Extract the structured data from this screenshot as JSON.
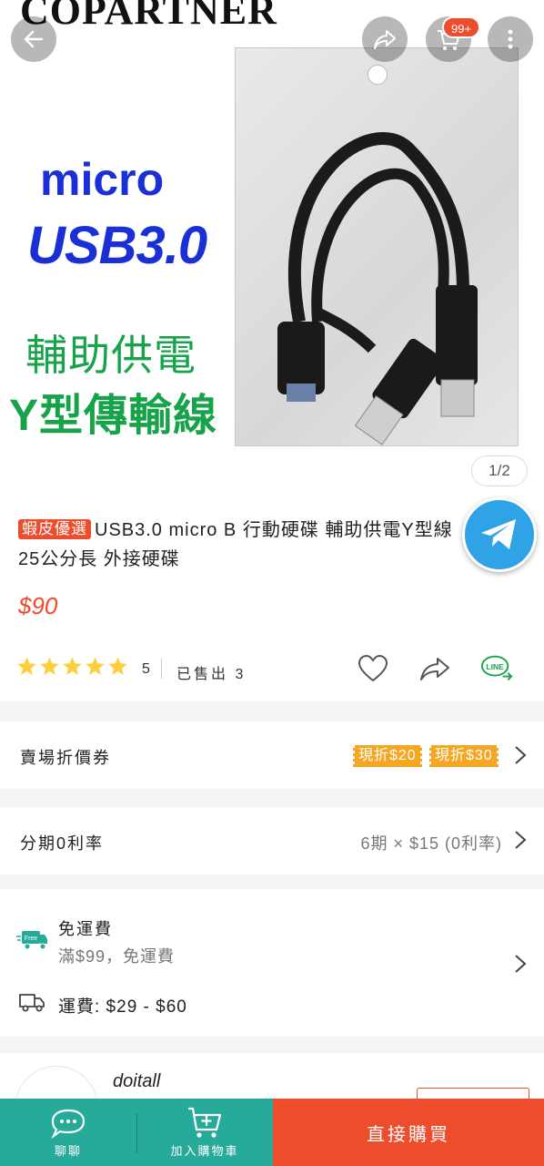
{
  "hero": {
    "brand": "COPARTNER",
    "promo_line1": "micro",
    "promo_line2": "USB3.0",
    "promo_line3": "輔助供電",
    "promo_line4": "Y型傳輸線",
    "cart_badge": "99+",
    "pager": "1/2"
  },
  "product": {
    "tag": "蝦皮優選",
    "title": "USB3.0 micro B 行動硬碟 輔助供電Y型線 25公分長 外接硬碟",
    "price": "$90",
    "rating": "5",
    "sold": "已售出 3",
    "stars": 5
  },
  "coupons": {
    "label": "賣場折價券",
    "items": [
      "現折$20",
      "現折$30"
    ]
  },
  "installment": {
    "label": "分期0利率",
    "value": "6期 × $15 (0利率)"
  },
  "shipping": {
    "free_title": "免運費",
    "free_detail": "滿$99，免運費",
    "fee": "運費: $29 - $60"
  },
  "seller": {
    "name": "doitall"
  },
  "bottom": {
    "chat": "聊聊",
    "add_cart": "加入購物車",
    "buy_now": "直接購買"
  },
  "colors": {
    "accent": "#ee4d2d",
    "teal": "#26aa99",
    "coupon": "#f5a623",
    "star": "#ffce3d"
  }
}
